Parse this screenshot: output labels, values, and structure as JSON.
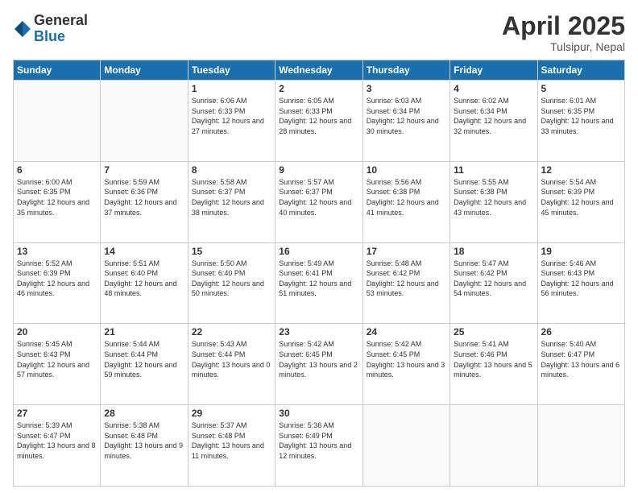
{
  "logo": {
    "general": "General",
    "blue": "Blue"
  },
  "title": {
    "month": "April 2025",
    "location": "Tulsipur, Nepal"
  },
  "weekdays": [
    "Sunday",
    "Monday",
    "Tuesday",
    "Wednesday",
    "Thursday",
    "Friday",
    "Saturday"
  ],
  "weeks": [
    [
      {
        "day": "",
        "sunrise": "",
        "sunset": "",
        "daylight": ""
      },
      {
        "day": "",
        "sunrise": "",
        "sunset": "",
        "daylight": ""
      },
      {
        "day": "1",
        "sunrise": "Sunrise: 6:06 AM",
        "sunset": "Sunset: 6:33 PM",
        "daylight": "Daylight: 12 hours and 27 minutes."
      },
      {
        "day": "2",
        "sunrise": "Sunrise: 6:05 AM",
        "sunset": "Sunset: 6:33 PM",
        "daylight": "Daylight: 12 hours and 28 minutes."
      },
      {
        "day": "3",
        "sunrise": "Sunrise: 6:03 AM",
        "sunset": "Sunset: 6:34 PM",
        "daylight": "Daylight: 12 hours and 30 minutes."
      },
      {
        "day": "4",
        "sunrise": "Sunrise: 6:02 AM",
        "sunset": "Sunset: 6:34 PM",
        "daylight": "Daylight: 12 hours and 32 minutes."
      },
      {
        "day": "5",
        "sunrise": "Sunrise: 6:01 AM",
        "sunset": "Sunset: 6:35 PM",
        "daylight": "Daylight: 12 hours and 33 minutes."
      }
    ],
    [
      {
        "day": "6",
        "sunrise": "Sunrise: 6:00 AM",
        "sunset": "Sunset: 6:35 PM",
        "daylight": "Daylight: 12 hours and 35 minutes."
      },
      {
        "day": "7",
        "sunrise": "Sunrise: 5:59 AM",
        "sunset": "Sunset: 6:36 PM",
        "daylight": "Daylight: 12 hours and 37 minutes."
      },
      {
        "day": "8",
        "sunrise": "Sunrise: 5:58 AM",
        "sunset": "Sunset: 6:37 PM",
        "daylight": "Daylight: 12 hours and 38 minutes."
      },
      {
        "day": "9",
        "sunrise": "Sunrise: 5:57 AM",
        "sunset": "Sunset: 6:37 PM",
        "daylight": "Daylight: 12 hours and 40 minutes."
      },
      {
        "day": "10",
        "sunrise": "Sunrise: 5:56 AM",
        "sunset": "Sunset: 6:38 PM",
        "daylight": "Daylight: 12 hours and 41 minutes."
      },
      {
        "day": "11",
        "sunrise": "Sunrise: 5:55 AM",
        "sunset": "Sunset: 6:38 PM",
        "daylight": "Daylight: 12 hours and 43 minutes."
      },
      {
        "day": "12",
        "sunrise": "Sunrise: 5:54 AM",
        "sunset": "Sunset: 6:39 PM",
        "daylight": "Daylight: 12 hours and 45 minutes."
      }
    ],
    [
      {
        "day": "13",
        "sunrise": "Sunrise: 5:52 AM",
        "sunset": "Sunset: 6:39 PM",
        "daylight": "Daylight: 12 hours and 46 minutes."
      },
      {
        "day": "14",
        "sunrise": "Sunrise: 5:51 AM",
        "sunset": "Sunset: 6:40 PM",
        "daylight": "Daylight: 12 hours and 48 minutes."
      },
      {
        "day": "15",
        "sunrise": "Sunrise: 5:50 AM",
        "sunset": "Sunset: 6:40 PM",
        "daylight": "Daylight: 12 hours and 50 minutes."
      },
      {
        "day": "16",
        "sunrise": "Sunrise: 5:49 AM",
        "sunset": "Sunset: 6:41 PM",
        "daylight": "Daylight: 12 hours and 51 minutes."
      },
      {
        "day": "17",
        "sunrise": "Sunrise: 5:48 AM",
        "sunset": "Sunset: 6:42 PM",
        "daylight": "Daylight: 12 hours and 53 minutes."
      },
      {
        "day": "18",
        "sunrise": "Sunrise: 5:47 AM",
        "sunset": "Sunset: 6:42 PM",
        "daylight": "Daylight: 12 hours and 54 minutes."
      },
      {
        "day": "19",
        "sunrise": "Sunrise: 5:46 AM",
        "sunset": "Sunset: 6:43 PM",
        "daylight": "Daylight: 12 hours and 56 minutes."
      }
    ],
    [
      {
        "day": "20",
        "sunrise": "Sunrise: 5:45 AM",
        "sunset": "Sunset: 6:43 PM",
        "daylight": "Daylight: 12 hours and 57 minutes."
      },
      {
        "day": "21",
        "sunrise": "Sunrise: 5:44 AM",
        "sunset": "Sunset: 6:44 PM",
        "daylight": "Daylight: 12 hours and 59 minutes."
      },
      {
        "day": "22",
        "sunrise": "Sunrise: 5:43 AM",
        "sunset": "Sunset: 6:44 PM",
        "daylight": "Daylight: 13 hours and 0 minutes."
      },
      {
        "day": "23",
        "sunrise": "Sunrise: 5:42 AM",
        "sunset": "Sunset: 6:45 PM",
        "daylight": "Daylight: 13 hours and 2 minutes."
      },
      {
        "day": "24",
        "sunrise": "Sunrise: 5:42 AM",
        "sunset": "Sunset: 6:45 PM",
        "daylight": "Daylight: 13 hours and 3 minutes."
      },
      {
        "day": "25",
        "sunrise": "Sunrise: 5:41 AM",
        "sunset": "Sunset: 6:46 PM",
        "daylight": "Daylight: 13 hours and 5 minutes."
      },
      {
        "day": "26",
        "sunrise": "Sunrise: 5:40 AM",
        "sunset": "Sunset: 6:47 PM",
        "daylight": "Daylight: 13 hours and 6 minutes."
      }
    ],
    [
      {
        "day": "27",
        "sunrise": "Sunrise: 5:39 AM",
        "sunset": "Sunset: 6:47 PM",
        "daylight": "Daylight: 13 hours and 8 minutes."
      },
      {
        "day": "28",
        "sunrise": "Sunrise: 5:38 AM",
        "sunset": "Sunset: 6:48 PM",
        "daylight": "Daylight: 13 hours and 9 minutes."
      },
      {
        "day": "29",
        "sunrise": "Sunrise: 5:37 AM",
        "sunset": "Sunset: 6:48 PM",
        "daylight": "Daylight: 13 hours and 11 minutes."
      },
      {
        "day": "30",
        "sunrise": "Sunrise: 5:36 AM",
        "sunset": "Sunset: 6:49 PM",
        "daylight": "Daylight: 13 hours and 12 minutes."
      },
      {
        "day": "",
        "sunrise": "",
        "sunset": "",
        "daylight": ""
      },
      {
        "day": "",
        "sunrise": "",
        "sunset": "",
        "daylight": ""
      },
      {
        "day": "",
        "sunrise": "",
        "sunset": "",
        "daylight": ""
      }
    ]
  ]
}
